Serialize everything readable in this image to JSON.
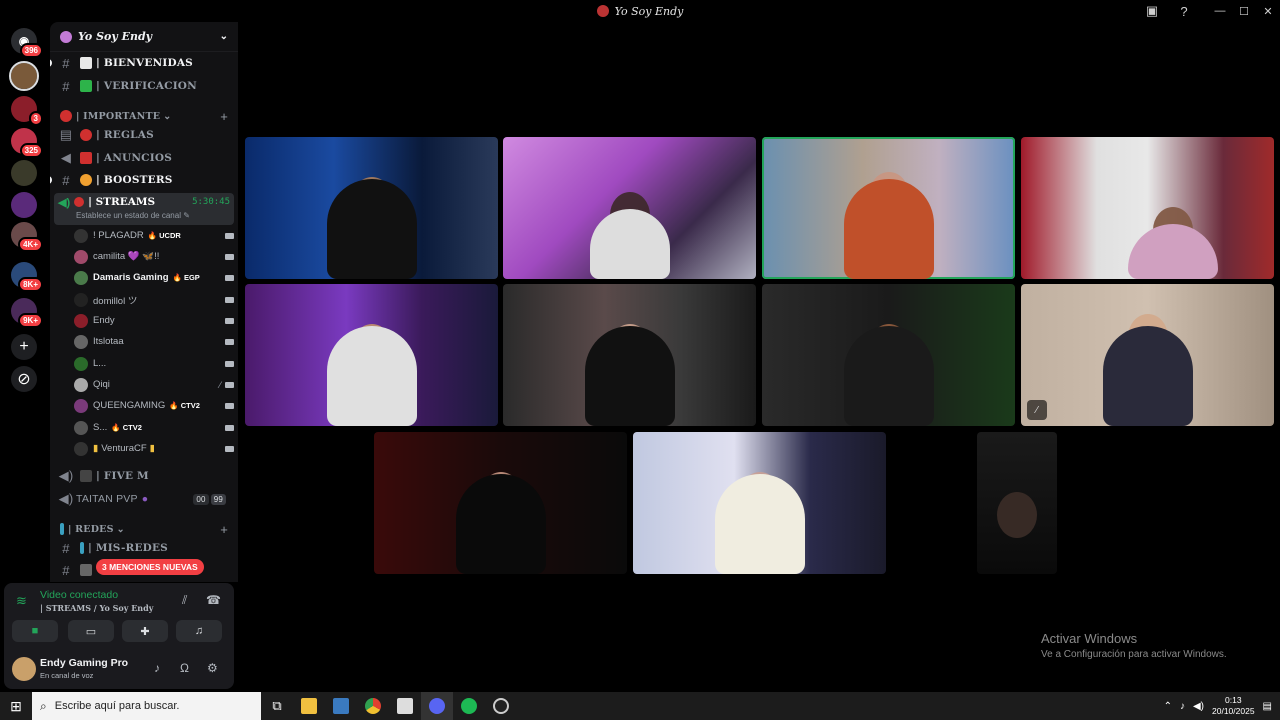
{
  "window": {
    "title": "Yo Soy Endy",
    "controls": [
      "—",
      "☐",
      "✕"
    ]
  },
  "rail": {
    "badges": [
      "396",
      "3",
      "325",
      "4K+",
      "8K+",
      "9K+"
    ]
  },
  "server": {
    "name": "Yo Soy Endy",
    "channels": [
      {
        "name": "| BIENVENIDAS"
      },
      {
        "name": "| VERIFICACION"
      }
    ],
    "categories": {
      "importante": "| IMPORTANTE",
      "redes": "| REDES"
    },
    "important_channels": [
      {
        "name": "| REGLAS"
      },
      {
        "name": "| ANUNCIOS"
      },
      {
        "name": "| BOOSTERS"
      }
    ],
    "streams": {
      "name": "| STREAMS",
      "timer": "5:30:45",
      "status": "Establece un estado de canal"
    },
    "voice_users": [
      {
        "name": "! PLAGADR",
        "tag": "UCDR"
      },
      {
        "name": "camilita 💜 🦋!!",
        "tag": ""
      },
      {
        "name": "Damaris Gaming",
        "tag": "EGP"
      },
      {
        "name": "domillol ツ",
        "tag": ""
      },
      {
        "name": "Endy",
        "tag": ""
      },
      {
        "name": "Itslotaa",
        "tag": ""
      },
      {
        "name": "L...",
        "tag": ""
      },
      {
        "name": "Qiqi",
        "tag": ""
      },
      {
        "name": "QUEENGAMING",
        "tag": "CTV2"
      },
      {
        "name": "S...",
        "tag": "CTV2"
      },
      {
        "name": "VenturaCF",
        "tag": ""
      }
    ],
    "other_voice": [
      {
        "name": "| FIVE M"
      },
      {
        "name": "TAITAN PVP",
        "count_a": "00",
        "count_b": "99"
      }
    ],
    "redes_channels": [
      {
        "name": "| MIS-REDES"
      }
    ],
    "mentions_pill": "3 MENCIONES NUEVAS"
  },
  "voice_panel": {
    "status": "Video conectado",
    "location": "| STREAMS / Yo Soy Endy"
  },
  "user_panel": {
    "name": "Endy Gaming Pro",
    "status": "En canal de voz"
  },
  "watermark": {
    "line1": "Activar Windows",
    "line2": "Ve a Configuración para activar Windows."
  },
  "taskbar": {
    "search_placeholder": "Escribe aquí para buscar.",
    "time": "0:13",
    "date": "20/10/2025"
  },
  "colors": {
    "accent_green": "#23a55a",
    "danger_red": "#f23f43",
    "background": "#000000",
    "sidebar": "#121214"
  }
}
